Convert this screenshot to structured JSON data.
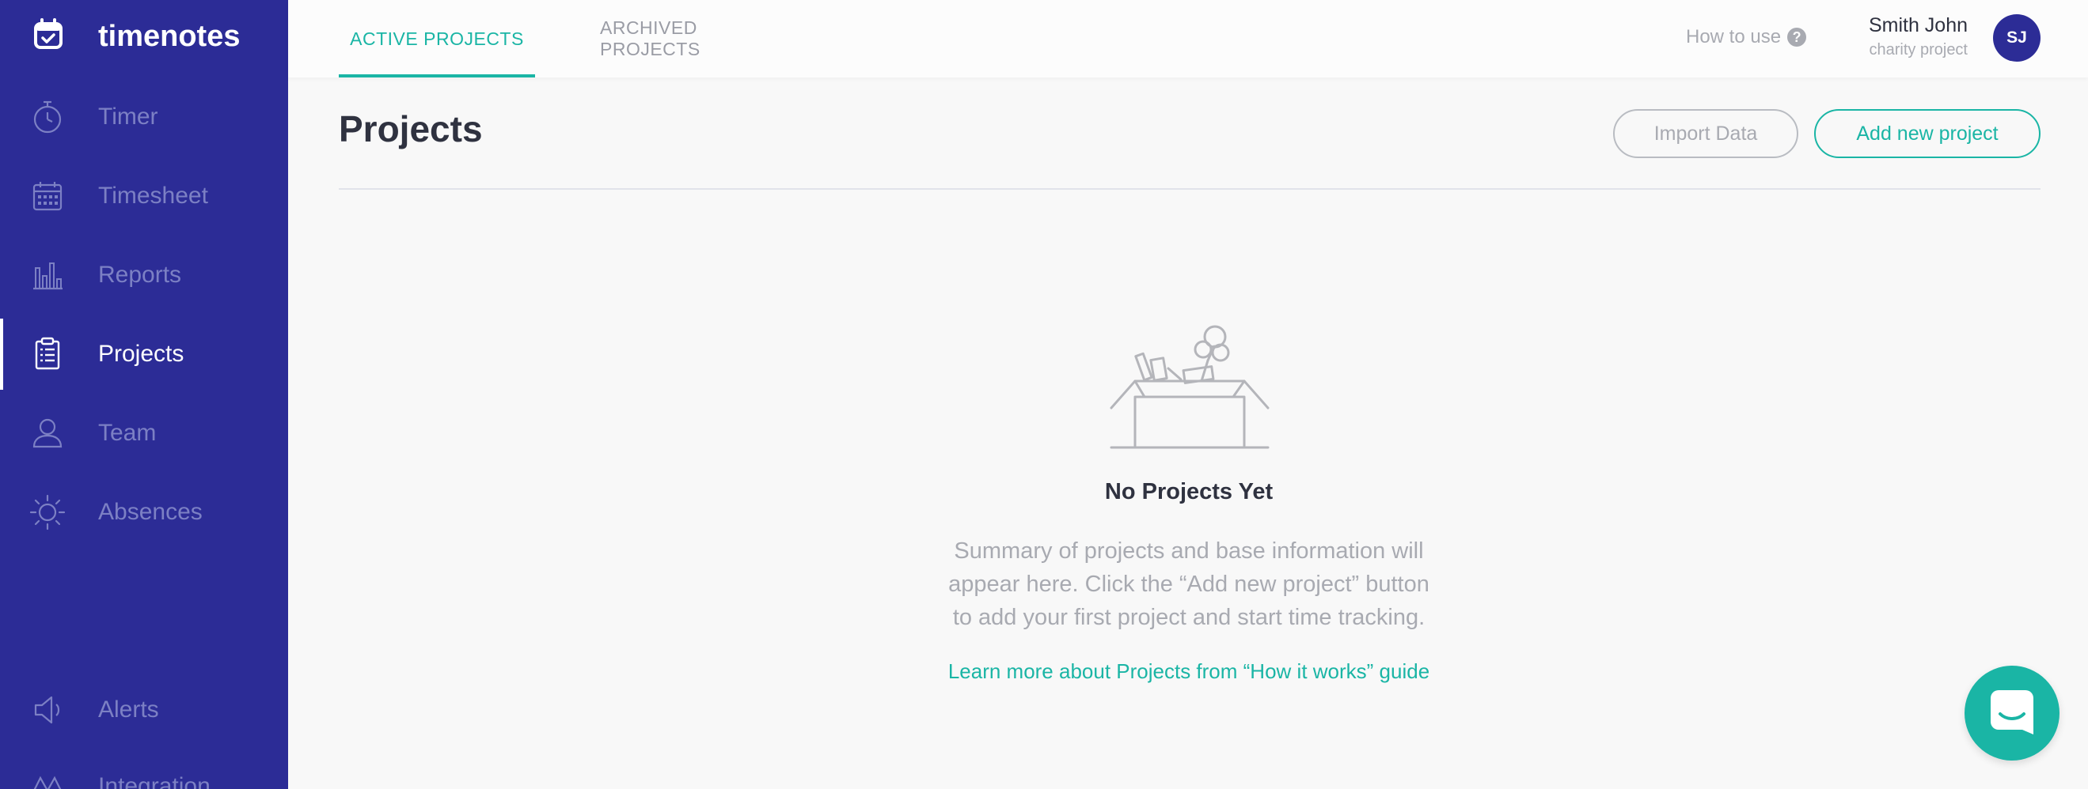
{
  "brand": {
    "name": "timenotes",
    "icon": "calendar-check-icon"
  },
  "sidebar": {
    "items": [
      {
        "label": "Timer",
        "icon": "stopwatch-icon",
        "active": false
      },
      {
        "label": "Timesheet",
        "icon": "calendar-grid-icon",
        "active": false
      },
      {
        "label": "Reports",
        "icon": "bar-chart-icon",
        "active": false
      },
      {
        "label": "Projects",
        "icon": "clipboard-icon",
        "active": true
      },
      {
        "label": "Team",
        "icon": "person-icon",
        "active": false
      },
      {
        "label": "Absences",
        "icon": "sun-icon",
        "active": false
      },
      {
        "label": "Alerts",
        "icon": "megaphone-icon",
        "active": false
      },
      {
        "label": "Integration",
        "icon": "integration-icon",
        "active": false
      }
    ]
  },
  "tabs": [
    {
      "label": "ACTIVE PROJECTS",
      "active": true
    },
    {
      "label": "ARCHIVED PROJECTS",
      "active": false
    }
  ],
  "header": {
    "how_to_use": "How to use",
    "help_icon": "question-circle-icon",
    "user_name": "Smith John",
    "user_org": "charity project",
    "avatar_initials": "SJ"
  },
  "main": {
    "title": "Projects",
    "import_label": "Import Data",
    "add_label": "Add new project",
    "empty_title": "No Projects Yet",
    "empty_desc_lines": [
      "Summary of projects and base information will",
      "appear here. Click the “Add new project” button",
      "to add your first project and start time tracking."
    ],
    "learn_more": "Learn more about Projects from “How it works” guide",
    "empty_icon": "empty-box-icon"
  },
  "chat": {
    "icon": "chat-icon"
  },
  "colors": {
    "sidebar_bg": "#2c2c96",
    "accent": "#1ab5a5",
    "muted_text": "#a8aab1",
    "dark_text": "#2f3240",
    "page_bg": "#f8f8f8"
  }
}
